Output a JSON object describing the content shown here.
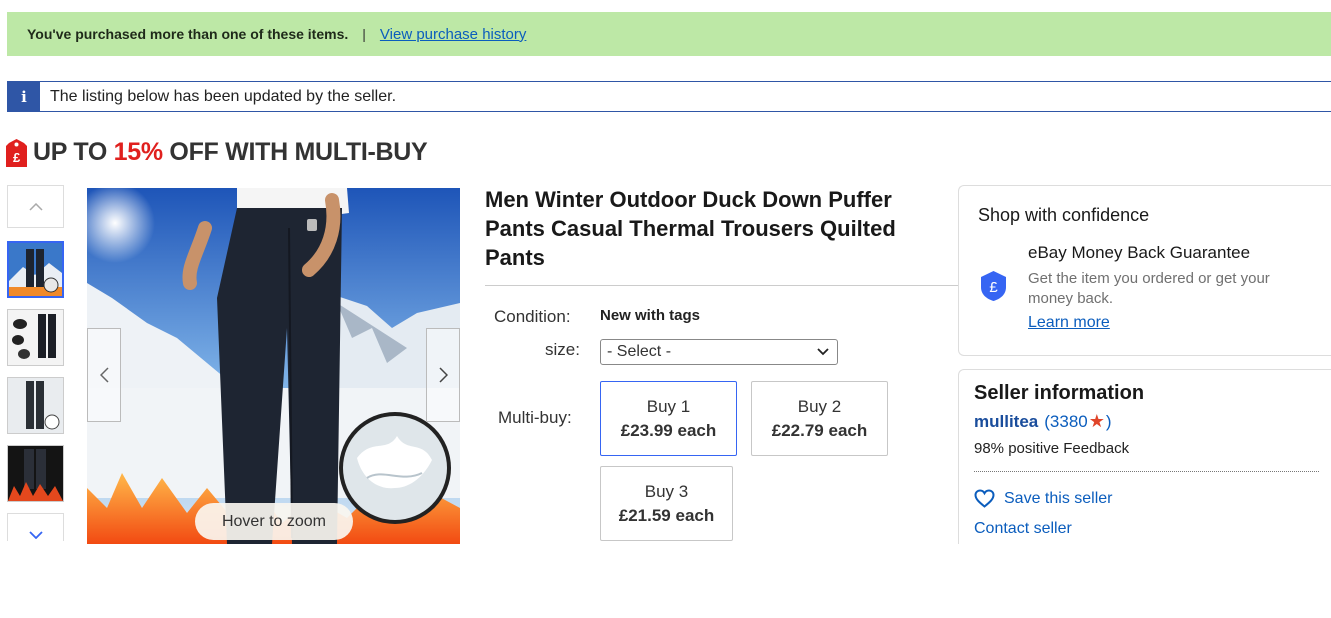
{
  "purchase_banner": {
    "message": "You've purchased more than one of these items.",
    "separator": "|",
    "link": "View purchase history"
  },
  "update_banner": {
    "icon": "i",
    "text": "The listing below has been updated by the seller."
  },
  "promo": {
    "prefix": "UP TO ",
    "percent": "15%",
    "suffix": " OFF WITH MULTI-BUY",
    "icon": "price-tag-icon",
    "colors": {
      "percent": "#e0201e",
      "tag": "#e0201e"
    }
  },
  "gallery": {
    "zoom_hint": "Hover to zoom",
    "thumbnail_count": 4,
    "active_index": 0
  },
  "listing": {
    "title": "Men Winter Outdoor Duck Down Puffer Pants Casual Thermal Trousers Quilted Pants",
    "condition_label": "Condition:",
    "condition_value": "New with tags",
    "size_label": "size:",
    "size_selected": "- Select -",
    "multibuy_label": "Multi-buy:",
    "multibuy": [
      {
        "qty": "Buy 1",
        "price": "£23.99 each",
        "selected": true
      },
      {
        "qty": "Buy 2",
        "price": "£22.79 each",
        "selected": false
      },
      {
        "qty": "Buy 3",
        "price": "£21.59 each",
        "selected": false
      }
    ]
  },
  "confidence": {
    "heading": "Shop with confidence",
    "guarantee_title": "eBay Money Back Guarantee",
    "guarantee_desc": "Get the item you ordered or get your money back.",
    "learn_more": "Learn more",
    "icon": "shield-pound-icon",
    "color": "#3665f3"
  },
  "seller": {
    "heading": "Seller information",
    "name": "mullitea",
    "score_open": "(3380",
    "score_close": ")",
    "feedback": "98% positive Feedback",
    "save": "Save this seller",
    "contact": "Contact seller",
    "star_icon": "star-icon",
    "star_color": "#e0452a"
  }
}
